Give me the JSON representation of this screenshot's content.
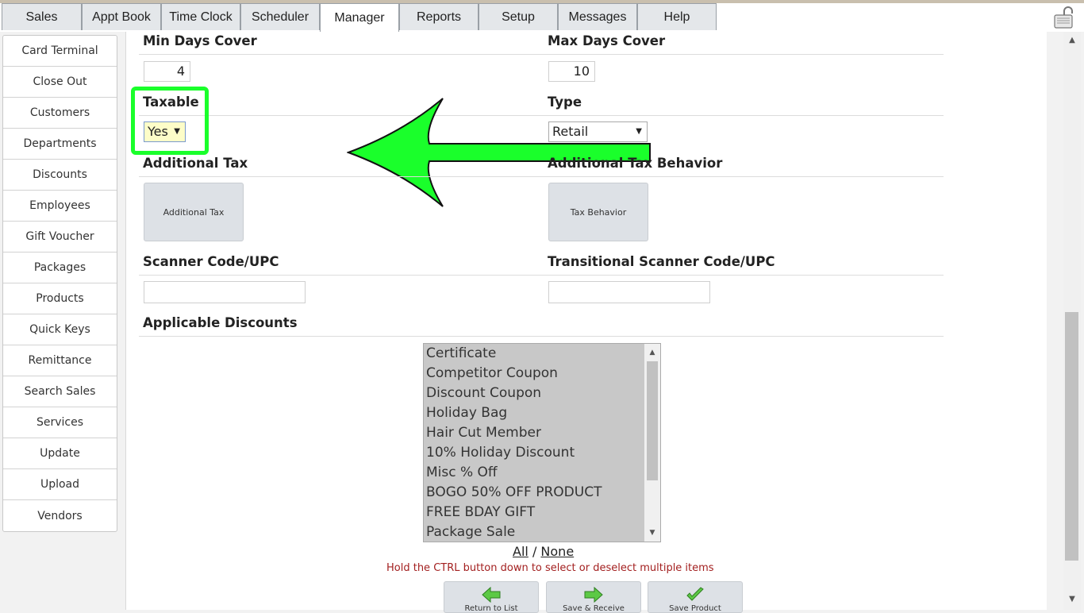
{
  "top_tabs": [
    "Sales",
    "Appt Book",
    "Time Clock",
    "Scheduler",
    "Manager",
    "Reports",
    "Setup",
    "Messages",
    "Help"
  ],
  "active_tab": "Manager",
  "sidebar": {
    "items": [
      "Card Terminal",
      "Close Out",
      "Customers",
      "Departments",
      "Discounts",
      "Employees",
      "Gift Voucher",
      "Packages",
      "Products",
      "Quick Keys",
      "Remittance",
      "Search Sales",
      "Services",
      "Update",
      "Upload",
      "Vendors"
    ]
  },
  "form": {
    "min_days_cover_label": "Min Days Cover",
    "min_days_cover_value": "4",
    "max_days_cover_label": "Max Days Cover",
    "max_days_cover_value": "10",
    "taxable_label": "Taxable",
    "taxable_value": "Yes",
    "type_label": "Type",
    "type_value": "Retail",
    "additional_tax_label": "Additional Tax",
    "additional_tax_button": "Additional Tax",
    "additional_tax_behavior_label": "Additional Tax Behavior",
    "tax_behavior_button": "Tax Behavior",
    "scanner_code_label": "Scanner Code/UPC",
    "scanner_code_value": "",
    "transitional_scanner_label": "Transitional Scanner Code/UPC",
    "transitional_scanner_value": "",
    "applicable_discounts_label": "Applicable Discounts",
    "discounts": [
      "Certificate",
      "Competitor Coupon",
      "Discount Coupon",
      "Holiday Bag",
      "Hair Cut Member",
      "10% Holiday Discount",
      "Misc % Off",
      "BOGO 50% OFF PRODUCT",
      "FREE BDAY GIFT",
      "Package Sale"
    ],
    "select_all": "All",
    "separator": "/",
    "select_none": "None",
    "hint": "Hold the CTRL button down to select or deselect multiple items"
  },
  "actions": {
    "return_to_list": "Return to List",
    "save_receive": "Save & Receive",
    "save_product": "Save Product"
  },
  "colors": {
    "highlight": "#1aff2b",
    "hint_text": "#a32020"
  },
  "icons": {
    "lock": "lock-icon",
    "return": "left-arrow-icon",
    "save_receive": "right-arrow-icon",
    "save": "checkmark-icon"
  }
}
